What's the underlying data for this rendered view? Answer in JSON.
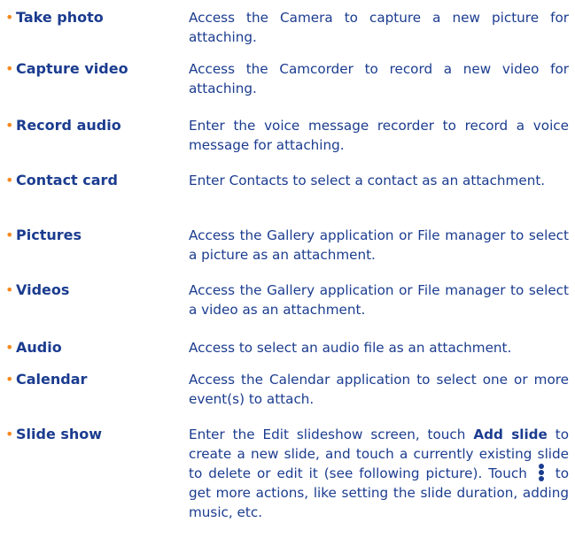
{
  "items": [
    {
      "term": "Take photo",
      "desc": "Access the Camera to capture a new picture for attaching."
    },
    {
      "term": "Capture video",
      "desc": "Access the Camcorder to record a new video for attaching."
    },
    {
      "term": "Record audio",
      "desc": "Enter the voice message recorder to record a voice message for attaching."
    },
    {
      "term": "Contact card",
      "desc": "Enter Contacts to select a contact as an attachment."
    },
    {
      "term": "Pictures",
      "desc": "Access the Gallery application or File manager to select a picture as an attachment."
    },
    {
      "term": "Videos",
      "desc": "Access the Gallery application or File manager to select a video as an attachment."
    },
    {
      "term": "Audio",
      "desc": "Access to select an audio file as an attachment."
    },
    {
      "term": "Calendar",
      "desc": "Access the Calendar application to select one or more event(s) to attach."
    },
    {
      "term": "Slide show",
      "desc_a": "Enter the Edit slideshow screen, touch ",
      "desc_b": "Add slide",
      "desc_c": " to create a new slide, and touch a currently existing slide to delete or edit it (see following picture). Touch ",
      "desc_d": " to get more actions, like setting the slide duration, adding music, etc."
    }
  ],
  "bullet_char": "•",
  "colors": {
    "text": "#1b3c8f",
    "bullet": "#f58a1f"
  },
  "icons": {
    "more": "more-vertical-icon"
  }
}
